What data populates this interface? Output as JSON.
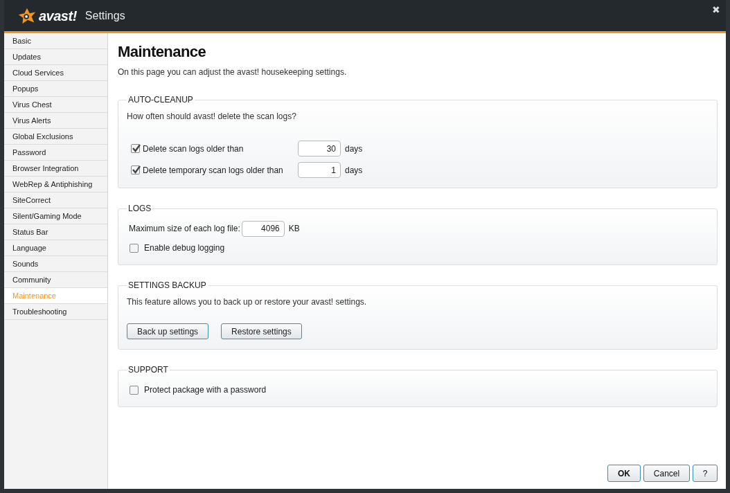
{
  "window": {
    "logo": "avast!",
    "title": "Settings",
    "close": "✖"
  },
  "sidebar": {
    "items": [
      {
        "label": "Basic",
        "selected": false
      },
      {
        "label": "Updates",
        "selected": false
      },
      {
        "label": "Cloud Services",
        "selected": false
      },
      {
        "label": "Popups",
        "selected": false
      },
      {
        "label": "Virus Chest",
        "selected": false
      },
      {
        "label": "Virus Alerts",
        "selected": false
      },
      {
        "label": "Global Exclusions",
        "selected": false
      },
      {
        "label": "Password",
        "selected": false
      },
      {
        "label": "Browser Integration",
        "selected": false
      },
      {
        "label": "WebRep & Antiphishing",
        "selected": false
      },
      {
        "label": "SiteCorrect",
        "selected": false
      },
      {
        "label": "Silent/Gaming Mode",
        "selected": false
      },
      {
        "label": "Status Bar",
        "selected": false
      },
      {
        "label": "Language",
        "selected": false
      },
      {
        "label": "Sounds",
        "selected": false
      },
      {
        "label": "Community",
        "selected": false
      },
      {
        "label": "Maintenance",
        "selected": true
      },
      {
        "label": "Troubleshooting",
        "selected": false
      }
    ]
  },
  "page": {
    "title": "Maintenance",
    "description": "On this page you can adjust the avast! housekeeping settings."
  },
  "sections": [
    {
      "title": "AUTO-CLEANUP",
      "items": [
        {
          "kind": "note",
          "text": "How often should avast! delete the scan logs?"
        },
        {
          "kind": "checkbox_number",
          "label": "Delete scan logs older than",
          "checked": true,
          "value": "30",
          "unit": "days"
        },
        {
          "kind": "checkbox_number",
          "label": "Delete temporary scan logs older than",
          "checked": true,
          "value": "1",
          "unit": "days"
        }
      ]
    },
    {
      "title": "LOGS",
      "items": [
        {
          "kind": "number",
          "label": "Maximum size of each log file:",
          "value": "4096",
          "unit": "KB"
        },
        {
          "kind": "checkbox",
          "label": "Enable debug logging",
          "checked": false
        }
      ]
    },
    {
      "title": "SETTINGS BACKUP",
      "items": [
        {
          "kind": "note",
          "text": "This feature allows you to back up or restore your avast! settings."
        },
        {
          "kind": "buttons",
          "buttons": [
            "Back up settings",
            "Restore settings"
          ]
        }
      ]
    },
    {
      "title": "SUPPORT",
      "items": [
        {
          "kind": "checkbox",
          "label": "Protect package with a password",
          "checked": false
        }
      ]
    }
  ],
  "footer": {
    "buttons": [
      {
        "label": "OK",
        "kind": "default"
      },
      {
        "label": "Cancel",
        "kind": "normal"
      },
      {
        "label": "?",
        "kind": "help"
      }
    ]
  }
}
